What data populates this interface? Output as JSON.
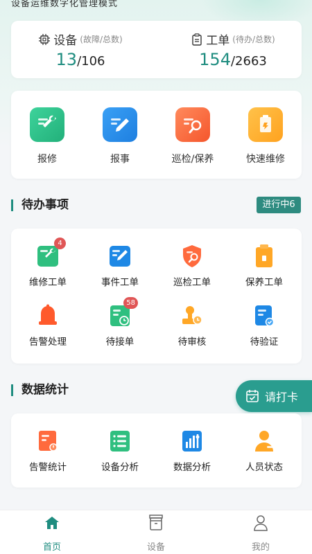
{
  "header": {
    "tagline": "设备运维数字化管理模式"
  },
  "stats": {
    "device": {
      "label": "设备",
      "sub": "(故障/总数)",
      "value_a": "13",
      "value_b": "/106"
    },
    "workorder": {
      "label": "工单",
      "sub": "(待办/总数)",
      "value_a": "154",
      "value_b": "/2663"
    }
  },
  "quick_actions": [
    {
      "label": "报修",
      "icon": "wrench-icon"
    },
    {
      "label": "报事",
      "icon": "pencil-icon"
    },
    {
      "label": "巡检/保养",
      "icon": "inspect-icon"
    },
    {
      "label": "快速维修",
      "icon": "fast-repair-icon"
    }
  ],
  "todo": {
    "title": "待办事项",
    "status": "进行中6",
    "items": [
      {
        "label": "维修工单",
        "badge": "4"
      },
      {
        "label": "事件工单",
        "badge": ""
      },
      {
        "label": "巡检工单",
        "badge": ""
      },
      {
        "label": "保养工单",
        "badge": ""
      },
      {
        "label": "告警处理",
        "badge": ""
      },
      {
        "label": "待接单",
        "badge": "58"
      },
      {
        "label": "待审核",
        "badge": ""
      },
      {
        "label": "待验证",
        "badge": ""
      }
    ]
  },
  "stats_section": {
    "title": "数据统计",
    "items": [
      {
        "label": "告警统计"
      },
      {
        "label": "设备分析"
      },
      {
        "label": "数据分析"
      },
      {
        "label": "人员状态"
      }
    ]
  },
  "checkin": {
    "label": "请打卡"
  },
  "tabbar": [
    {
      "label": "首页",
      "active": true
    },
    {
      "label": "设备",
      "active": false
    },
    {
      "label": "我的",
      "active": false
    }
  ],
  "colors": {
    "accent": "#1f8d80",
    "green": "#2fbf7f",
    "blue": "#1e88e5",
    "orange": "#ff6a3d",
    "amber": "#ffa726",
    "red": "#e05656"
  }
}
